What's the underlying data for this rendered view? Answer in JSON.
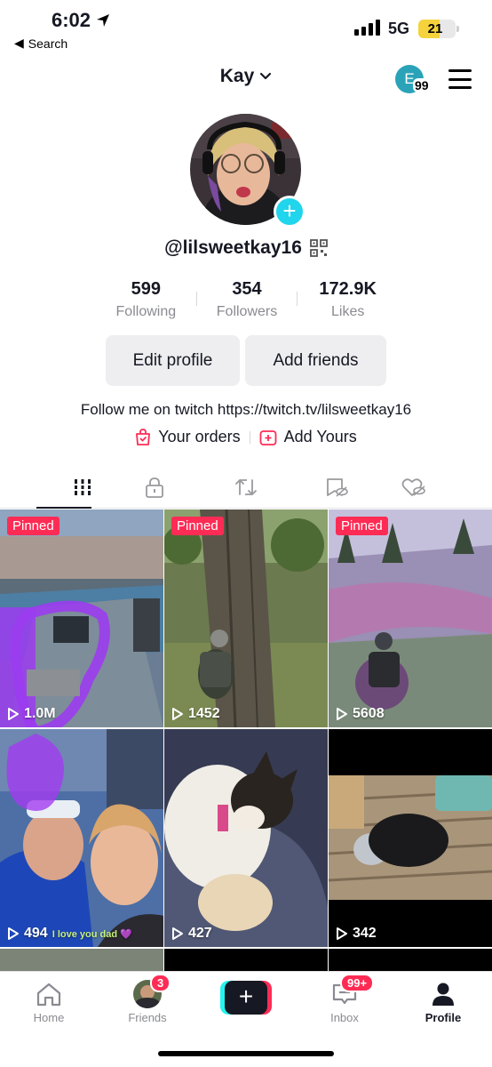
{
  "status_bar": {
    "time": "6:02",
    "back_label": "Search",
    "network": "5G",
    "battery": "21"
  },
  "header": {
    "title": "Kay",
    "avatar_letter": "E",
    "notification_count": "99"
  },
  "profile": {
    "username": "@lilsweetkay16",
    "stats": [
      {
        "value": "599",
        "label": "Following"
      },
      {
        "value": "354",
        "label": "Followers"
      },
      {
        "value": "172.9K",
        "label": "Likes"
      }
    ],
    "edit_profile_label": "Edit profile",
    "add_friends_label": "Add friends",
    "bio": "Follow me on twitch https://twitch.tv/lilsweetkay16",
    "orders_label": "Your orders",
    "add_yours_label": "Add Yours"
  },
  "tabs": [
    {
      "icon": "videos-grid-icon",
      "active": true
    },
    {
      "icon": "lock-icon",
      "active": false
    },
    {
      "icon": "repost-icon",
      "active": false
    },
    {
      "icon": "bookmark-hidden-icon",
      "active": false
    },
    {
      "icon": "liked-hidden-icon",
      "active": false
    }
  ],
  "videos": [
    {
      "pinned": "Pinned",
      "views": "1.0M"
    },
    {
      "pinned": "Pinned",
      "views": "1452"
    },
    {
      "pinned": "Pinned",
      "views": "5608"
    },
    {
      "views": "494",
      "caption": "I love you dad 💜"
    },
    {
      "views": "427"
    },
    {
      "views": "342"
    }
  ],
  "bottom_nav": {
    "home": "Home",
    "friends": "Friends",
    "friends_badge": "3",
    "inbox": "Inbox",
    "inbox_badge": "99+",
    "profile": "Profile"
  },
  "colors": {
    "accent": "#fe2c55",
    "cyan": "#25f4ee",
    "avatar_plus": "#20d5ec"
  }
}
